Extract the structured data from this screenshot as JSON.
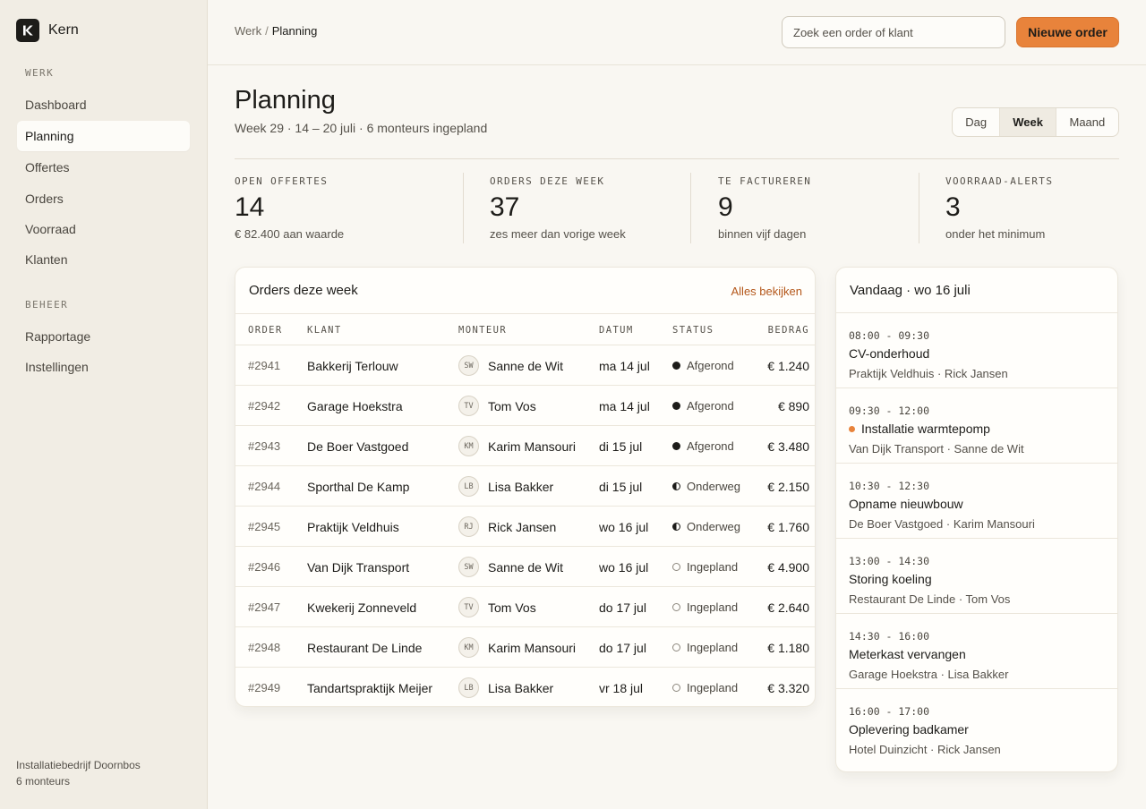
{
  "app": {
    "name": "Kern",
    "logo_letter": "K"
  },
  "sidebar": {
    "section_work": "WERK",
    "work_items": [
      {
        "label": "Dashboard",
        "active": false
      },
      {
        "label": "Planning",
        "active": true
      },
      {
        "label": "Offertes",
        "active": false
      },
      {
        "label": "Orders",
        "active": false
      },
      {
        "label": "Voorraad",
        "active": false
      },
      {
        "label": "Klanten",
        "active": false
      }
    ],
    "section_admin": "BEHEER",
    "admin_items": [
      {
        "label": "Rapportage"
      },
      {
        "label": "Instellingen"
      }
    ],
    "company_name": "Installatiebedrijf Doornbos",
    "company_sub": "6 monteurs"
  },
  "topbar": {
    "breadcrumb_parent": "Werk",
    "breadcrumb_sep": "/",
    "breadcrumb_current": "Planning",
    "search_placeholder": "Zoek een order of klant",
    "new_order_label": "Nieuwe order"
  },
  "header": {
    "title": "Planning",
    "subtitle": "Week 29 · 14 – 20 juli · 6 monteurs ingepland",
    "views": [
      "Dag",
      "Week",
      "Maand"
    ],
    "active_view": "Week"
  },
  "stats": [
    {
      "label": "OPEN OFFERTES",
      "value": "14",
      "note": "€ 82.400 aan waarde"
    },
    {
      "label": "ORDERS DEZE WEEK",
      "value": "37",
      "note": "zes meer dan vorige week"
    },
    {
      "label": "TE FACTUREREN",
      "value": "9",
      "note": "binnen vijf dagen"
    },
    {
      "label": "VOORRAAD-ALERTS",
      "value": "3",
      "note": "onder het minimum"
    }
  ],
  "orders": {
    "title": "Orders deze week",
    "view_all": "Alles bekijken",
    "columns": {
      "order": "ORDER",
      "klant": "KLANT",
      "monteur": "MONTEUR",
      "datum": "DATUM",
      "status": "STATUS",
      "bedrag": "BEDRAG"
    },
    "rows": [
      {
        "order": "#2941",
        "klant": "Bakkerij Terlouw",
        "initials": "SW",
        "monteur": "Sanne de Wit",
        "datum": "ma 14 jul",
        "status": "Afgerond",
        "state": "done",
        "bedrag": "€ 1.240"
      },
      {
        "order": "#2942",
        "klant": "Garage Hoekstra",
        "initials": "TV",
        "monteur": "Tom Vos",
        "datum": "ma 14 jul",
        "status": "Afgerond",
        "state": "done",
        "bedrag": "€ 890"
      },
      {
        "order": "#2943",
        "klant": "De Boer Vastgoed",
        "initials": "KM",
        "monteur": "Karim Mansouri",
        "datum": "di 15 jul",
        "status": "Afgerond",
        "state": "done",
        "bedrag": "€ 3.480"
      },
      {
        "order": "#2944",
        "klant": "Sporthal De Kamp",
        "initials": "LB",
        "monteur": "Lisa Bakker",
        "datum": "di 15 jul",
        "status": "Onderweg",
        "state": "half",
        "bedrag": "€ 2.150"
      },
      {
        "order": "#2945",
        "klant": "Praktijk Veldhuis",
        "initials": "RJ",
        "monteur": "Rick Jansen",
        "datum": "wo 16 jul",
        "status": "Onderweg",
        "state": "half",
        "bedrag": "€ 1.760"
      },
      {
        "order": "#2946",
        "klant": "Van Dijk Transport",
        "initials": "SW",
        "monteur": "Sanne de Wit",
        "datum": "wo 16 jul",
        "status": "Ingepland",
        "state": "plan",
        "bedrag": "€ 4.900"
      },
      {
        "order": "#2947",
        "klant": "Kwekerij Zonneveld",
        "initials": "TV",
        "monteur": "Tom Vos",
        "datum": "do 17 jul",
        "status": "Ingepland",
        "state": "plan",
        "bedrag": "€ 2.640"
      },
      {
        "order": "#2948",
        "klant": "Restaurant De Linde",
        "initials": "KM",
        "monteur": "Karim Mansouri",
        "datum": "do 17 jul",
        "status": "Ingepland",
        "state": "plan",
        "bedrag": "€ 1.180"
      },
      {
        "order": "#2949",
        "klant": "Tandartspraktijk Meijer",
        "initials": "LB",
        "monteur": "Lisa Bakker",
        "datum": "vr 18 jul",
        "status": "Ingepland",
        "state": "plan",
        "bedrag": "€ 3.320"
      }
    ]
  },
  "today": {
    "title": "Vandaag · wo 16 juli",
    "items": [
      {
        "time": "08:00 - 09:30",
        "title": "CV-onderhoud",
        "meta": "Praktijk Veldhuis · Rick Jansen",
        "live": false
      },
      {
        "time": "09:30 - 12:00",
        "title": "Installatie warmtepomp",
        "meta": "Van Dijk Transport · Sanne de Wit",
        "live": true
      },
      {
        "time": "10:30 - 12:30",
        "title": "Opname nieuwbouw",
        "meta": "De Boer Vastgoed · Karim Mansouri",
        "live": false
      },
      {
        "time": "13:00 - 14:30",
        "title": "Storing koeling",
        "meta": "Restaurant De Linde · Tom Vos",
        "live": false
      },
      {
        "time": "14:30 - 16:00",
        "title": "Meterkast vervangen",
        "meta": "Garage Hoekstra · Lisa Bakker",
        "live": false
      },
      {
        "time": "16:00 - 17:00",
        "title": "Oplevering badkamer",
        "meta": "Hotel Duinzicht · Rick Jansen",
        "live": false
      }
    ]
  },
  "colors": {
    "accent": "#e8833b",
    "link": "#b4571a",
    "sidebar_bg": "#f1ede4",
    "page_bg": "#f9f7f2"
  }
}
